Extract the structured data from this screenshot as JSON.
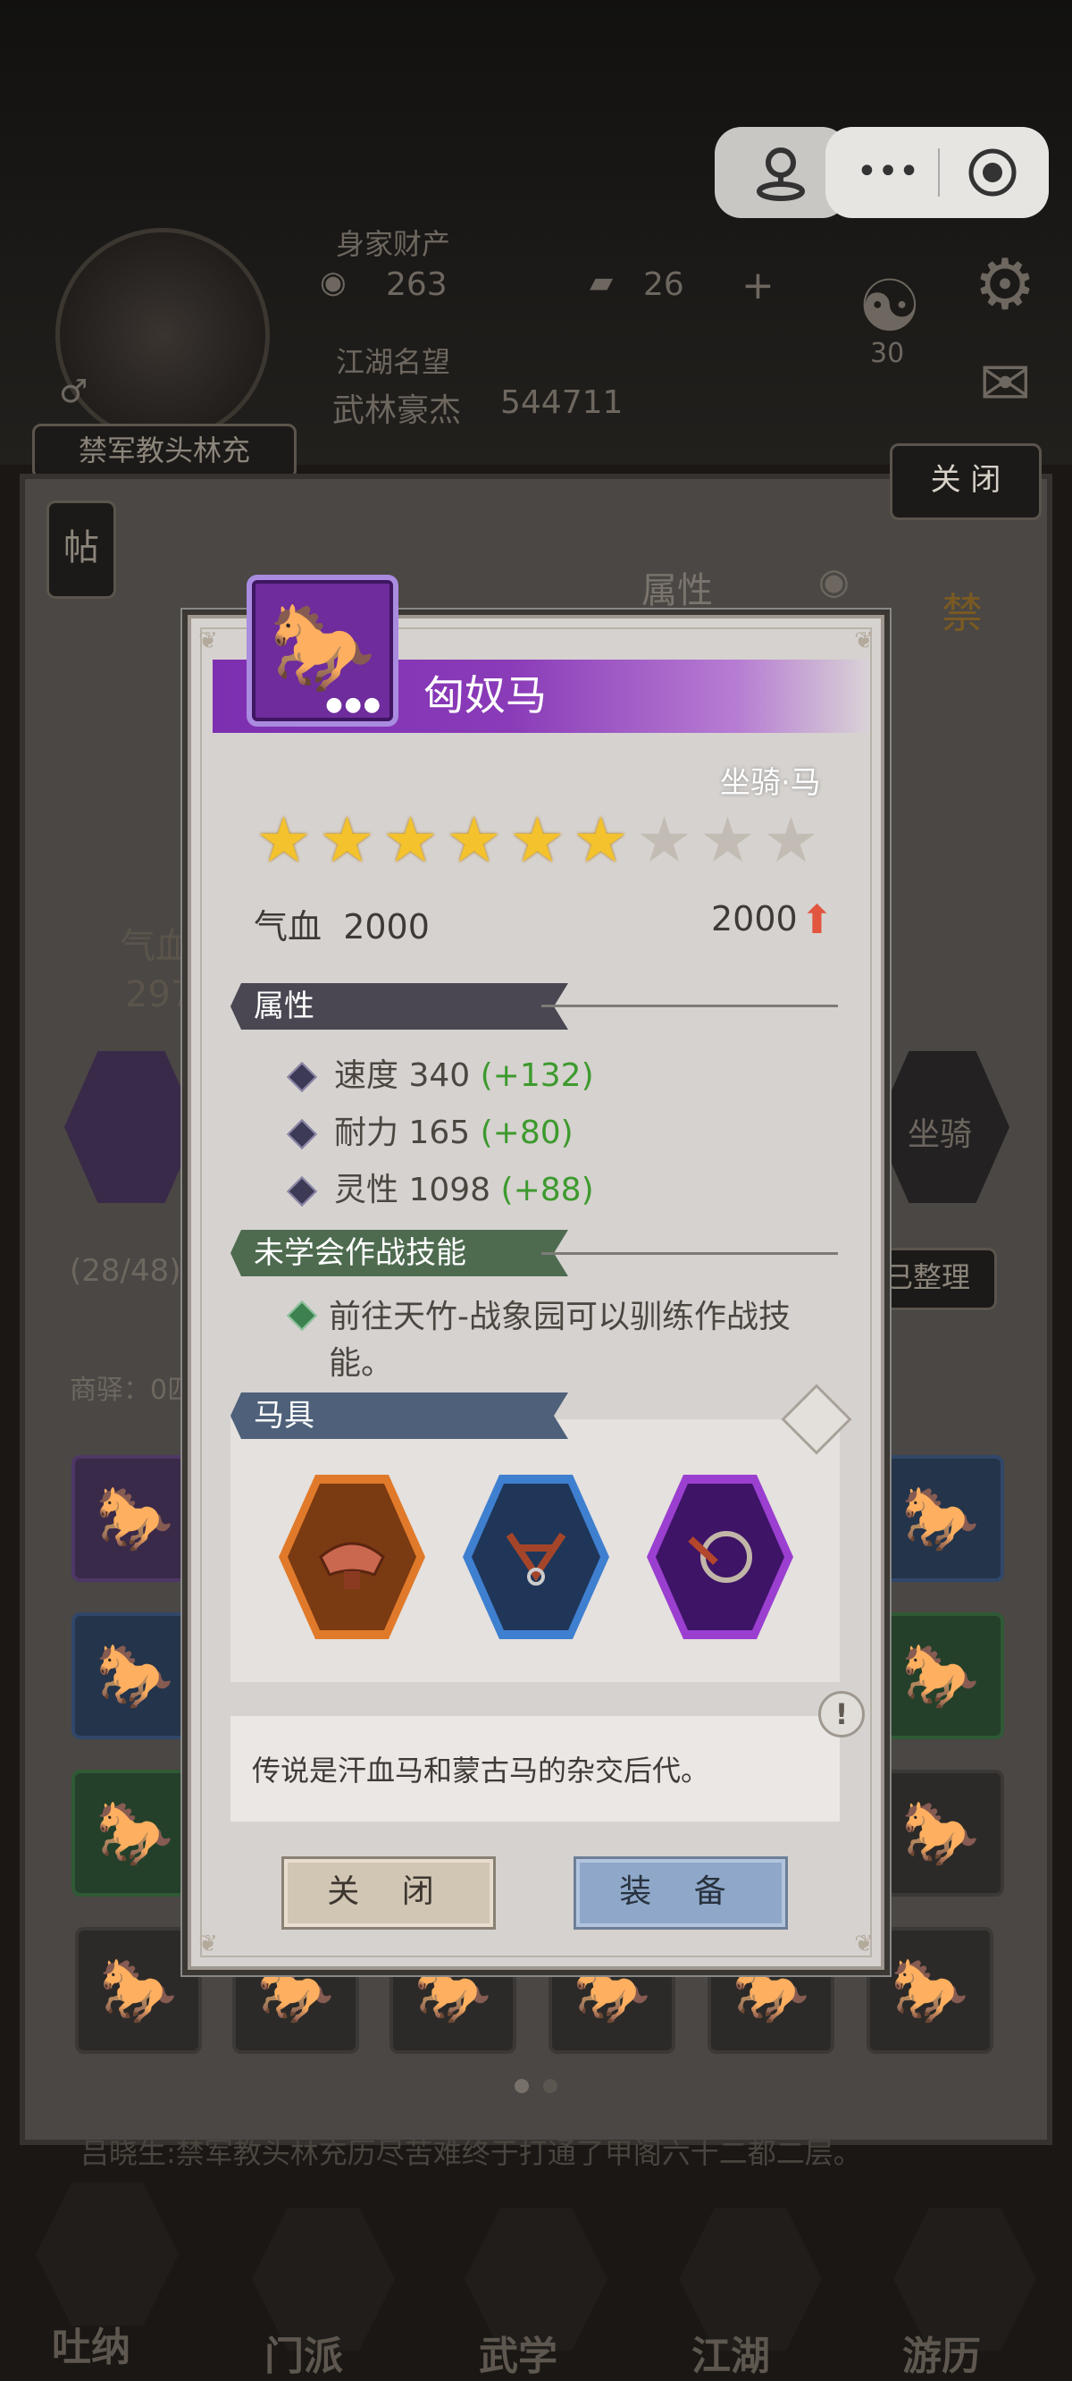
{
  "background": {
    "assets_label": "身家财产",
    "currency_1": "263",
    "currency_2": "26",
    "reputation_label": "江湖名望",
    "rank_title": "武林豪杰",
    "rank_score": "544711",
    "badge_number": "30",
    "character_name": "禁军教头林充",
    "close_label": "关 闭",
    "post_label": "帖",
    "attr_tab": "属性",
    "hp_partial": "气血",
    "hp_number_partial": "297",
    "slot_count": "(28/48)",
    "sort_label": "已整理",
    "inn_label": "商驿：0匹",
    "mount_label": "坐骑",
    "ticker": "吕晓生:禁军教头林充历尽苦难终于打通了甲阁六十二都二层。",
    "nav": [
      "吐纳",
      "门派",
      "武学",
      "江湖",
      "游历"
    ],
    "charm": "禁"
  },
  "modal": {
    "item_name": "匈奴马",
    "item_type": "坐骑·马",
    "stars_filled": 6,
    "stars_total": 9,
    "hp_label": "气血",
    "hp_value": "2000",
    "hp_compare": "2000",
    "attr_section": "属性",
    "attributes": [
      {
        "name": "速度",
        "value": "340",
        "bonus": "(+132)"
      },
      {
        "name": "耐力",
        "value": "165",
        "bonus": "(+80)"
      },
      {
        "name": "灵性",
        "value": "1098",
        "bonus": "(+88)"
      }
    ],
    "skill_section": "未学会作战技能",
    "skill_hint": "前往天竹-战象园可以驯练作战技能。",
    "gear_section": "马具",
    "gear": [
      {
        "name": "saddle-icon",
        "color": "#e07a2a"
      },
      {
        "name": "bridle-icon",
        "color": "#3f7fd0"
      },
      {
        "name": "bit-ring-icon",
        "color": "#9b3fd0"
      }
    ],
    "description": "传说是汗血马和蒙古马的杂交后代。",
    "close_button": "关 闭",
    "equip_button": "装 备",
    "colors": {
      "title_purple": "#7c2fb0",
      "bonus_green": "#3d9a2e",
      "attr_tag": "#4a4752",
      "skill_tag": "#4e6b50",
      "gear_tag": "#4e607a"
    }
  }
}
